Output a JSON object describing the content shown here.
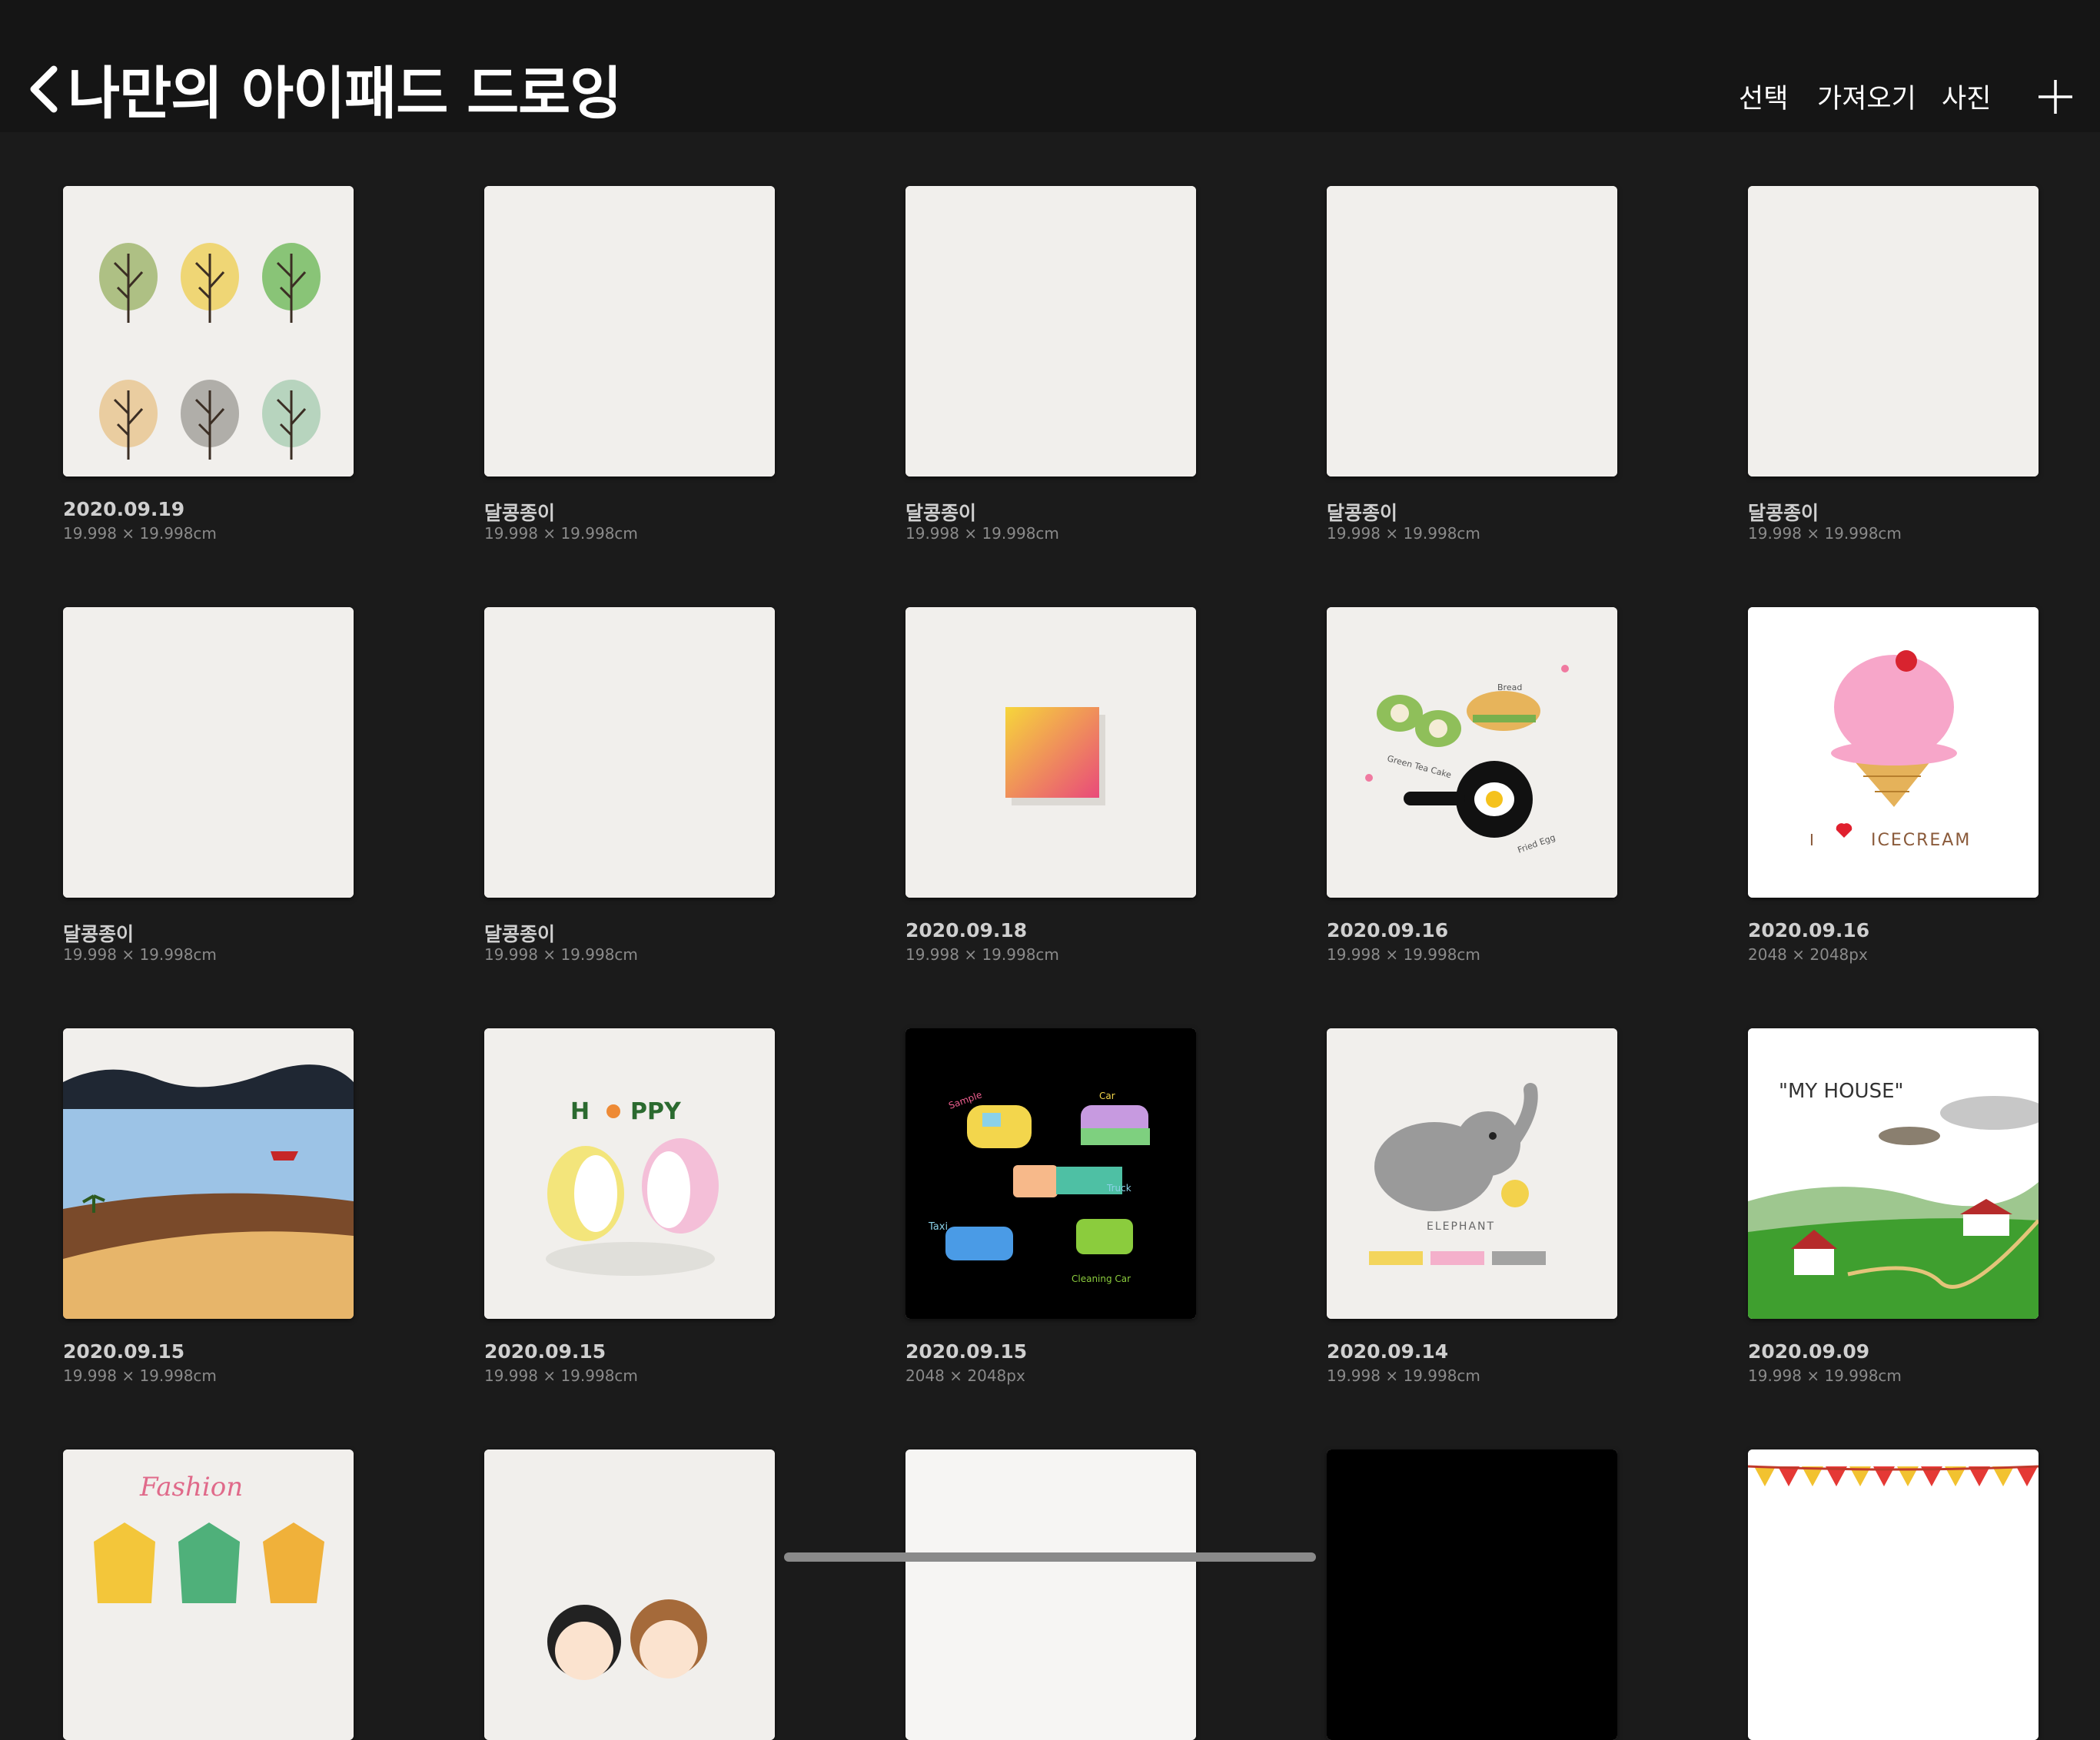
{
  "header": {
    "title": "나만의 아이패드 드로잉",
    "select_label": "선택",
    "import_label": "가져오기",
    "photo_label": "사진"
  },
  "artworks": [
    {
      "name": "2020.09.19",
      "size": "19.998 × 19.998cm",
      "thumb": "trees"
    },
    {
      "name": "달콩종이",
      "size": "19.998 × 19.998cm",
      "thumb": "blank"
    },
    {
      "name": "달콩종이",
      "size": "19.998 × 19.998cm",
      "thumb": "blank"
    },
    {
      "name": "달콩종이",
      "size": "19.998 × 19.998cm",
      "thumb": "blank"
    },
    {
      "name": "달콩종이",
      "size": "19.998 × 19.998cm",
      "thumb": "blank"
    },
    {
      "name": "달콩종이",
      "size": "19.998 × 19.998cm",
      "thumb": "blank"
    },
    {
      "name": "달콩종이",
      "size": "19.998 × 19.998cm",
      "thumb": "blank"
    },
    {
      "name": "2020.09.18",
      "size": "19.998 × 19.998cm",
      "thumb": "gradient-square"
    },
    {
      "name": "2020.09.16",
      "size": "19.998 × 19.998cm",
      "thumb": "food"
    },
    {
      "name": "2020.09.16",
      "size": "2048 × 2048px",
      "thumb": "icecream"
    },
    {
      "name": "2020.09.15",
      "size": "19.998 × 19.998cm",
      "thumb": "seaside"
    },
    {
      "name": "2020.09.15",
      "size": "19.998 × 19.998cm",
      "thumb": "hedgehogs"
    },
    {
      "name": "2020.09.15",
      "size": "2048 × 2048px",
      "thumb": "cars"
    },
    {
      "name": "2020.09.14",
      "size": "19.998 × 19.998cm",
      "thumb": "elephant"
    },
    {
      "name": "2020.09.09",
      "size": "19.998 × 19.998cm",
      "thumb": "house"
    },
    {
      "name": "",
      "size": "",
      "thumb": "fashion"
    },
    {
      "name": "",
      "size": "",
      "thumb": "kids"
    },
    {
      "name": "",
      "size": "",
      "thumb": "white"
    },
    {
      "name": "",
      "size": "",
      "thumb": "black"
    },
    {
      "name": "",
      "size": "",
      "thumb": "bunting"
    }
  ],
  "thumb_text": {
    "happy_h": "H",
    "happy_ppy": "PPY",
    "icecream_i": "I",
    "icecream_word": "ICECREAM",
    "house_title": "\"MY HOUSE\"",
    "elephant_word": "ELEPHANT",
    "fashion_word": "Fashion",
    "car_taxi": "Taxi",
    "car_truck": "Truck",
    "car_cleaning": "Cleaning Car",
    "car_car": "Car",
    "car_sample": "Sample",
    "food_cake": "Green Tea Cake",
    "food_bread": "Bread",
    "food_pan": "Fried Egg"
  },
  "colors": {
    "background": "#1b1b1b",
    "topbar": "#151515",
    "paper": "#f1efec"
  }
}
